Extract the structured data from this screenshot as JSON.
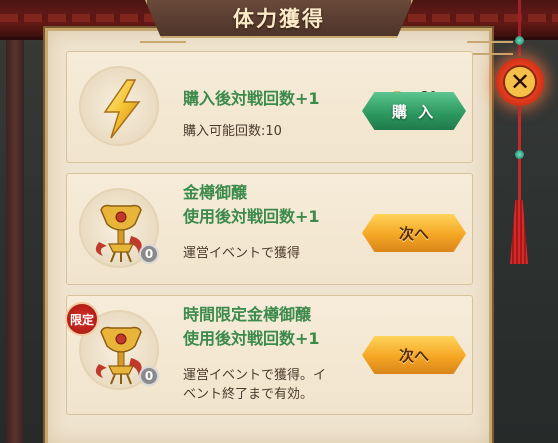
{
  "dialog": {
    "title": "体力獲得"
  },
  "items": [
    {
      "title": "購入後対戦回数+1",
      "desc": "購入可能回数:10",
      "price": "x30",
      "button": "購 入",
      "icon": "lightning-icon"
    },
    {
      "title_line1": "金樽御醸",
      "title_line2": "使用後対戦回数+1",
      "desc": "運営イベントで獲得",
      "count": "0",
      "button": "次へ",
      "icon": "golden-goblet-icon"
    },
    {
      "badge": "限定",
      "title_line1": "時間限定金樽御醸",
      "title_line2": "使用後対戦回数+1",
      "desc_line1": "運営イベントで獲得。イ",
      "desc_line2": "ベント終了まで有効。",
      "count": "0",
      "button": "次へ",
      "icon": "golden-goblet-icon"
    }
  ],
  "colors": {
    "title_green": "#3c8a4c",
    "button_green": "#2f9a62",
    "button_orange": "#f5a623",
    "close_red": "#e23a1c"
  },
  "icons": {
    "close": "close-icon",
    "currency": "gold-ingot-icon"
  }
}
